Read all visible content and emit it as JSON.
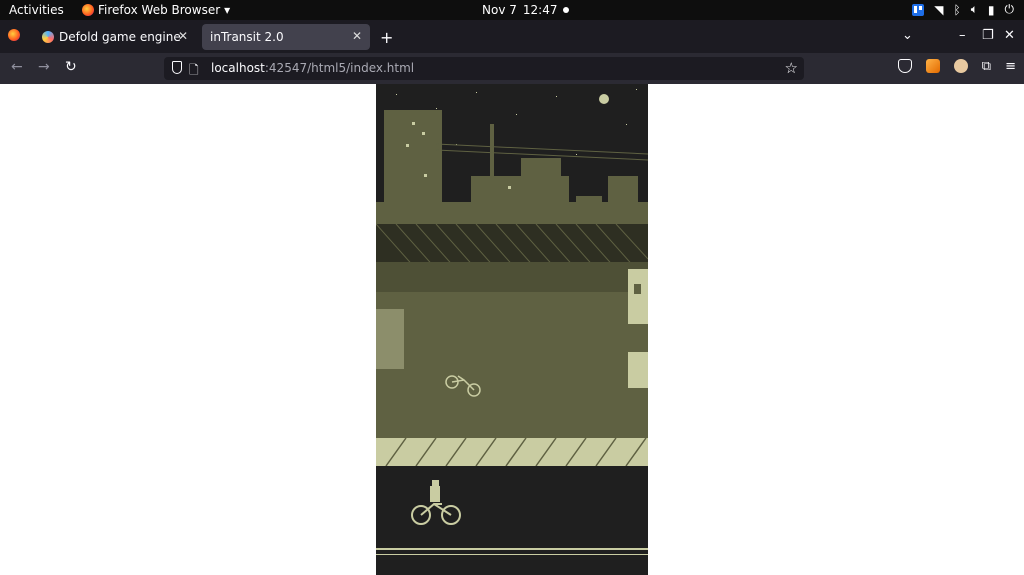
{
  "topbar": {
    "activities": "Activities",
    "app_menu": "Firefox Web Browser",
    "date": "Nov 7",
    "time": "12:47"
  },
  "tabs": [
    {
      "title": "Defold game engine foru",
      "active": false
    },
    {
      "title": "inTransit 2.0",
      "active": true
    }
  ],
  "urlbar": {
    "host": "localhost",
    "rest": ":42547/html5/index.html"
  },
  "colors": {
    "chrome_dark": "#1c1b22",
    "chrome_nav": "#2b2a33",
    "game_dark": "#1f1f1f",
    "game_mid": "#5f6142",
    "game_light": "#c9cca2"
  },
  "icons": [
    "firefox-icon",
    "back-icon",
    "forward-icon",
    "reload-icon",
    "shield-icon",
    "star-icon",
    "pocket-icon",
    "extensions-icon",
    "menu-icon",
    "wifi-icon",
    "bluetooth-icon",
    "volume-icon",
    "battery-icon",
    "power-icon",
    "trello-icon"
  ]
}
